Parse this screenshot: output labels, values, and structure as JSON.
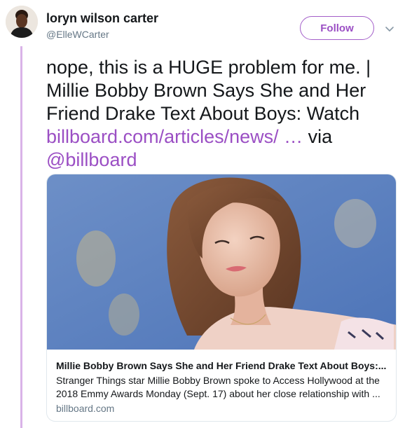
{
  "user": {
    "name": "loryn wilson carter",
    "handle": "@ElleWCarter"
  },
  "follow_button": {
    "label": "Follow"
  },
  "tweet": {
    "text_main": "nope, this is a HUGE problem for me. | Millie Bobby Brown Says She and Her Friend Drake Text About Boys: Watch",
    "link_text": "billboard.com/articles/news/",
    "link_ellipsis": "…",
    "via_text": "via",
    "mention": "@billboard"
  },
  "card": {
    "title": "Millie Bobby Brown Says She and Her Friend Drake Text About Boys:...",
    "description": "Stranger Things star Millie Bobby Brown spoke to Access Hollywood at the 2018 Emmy Awards Monday (Sept. 17) about her close relationship with ...",
    "domain": "billboard.com"
  },
  "icons": {
    "chevron": "chevron-down-icon",
    "avatar": "user-avatar"
  },
  "colors": {
    "accent": "#9b4fc4",
    "thread_line": "#d9b3e8",
    "card_border": "#e1e8ed",
    "secondary_text": "#657786"
  }
}
